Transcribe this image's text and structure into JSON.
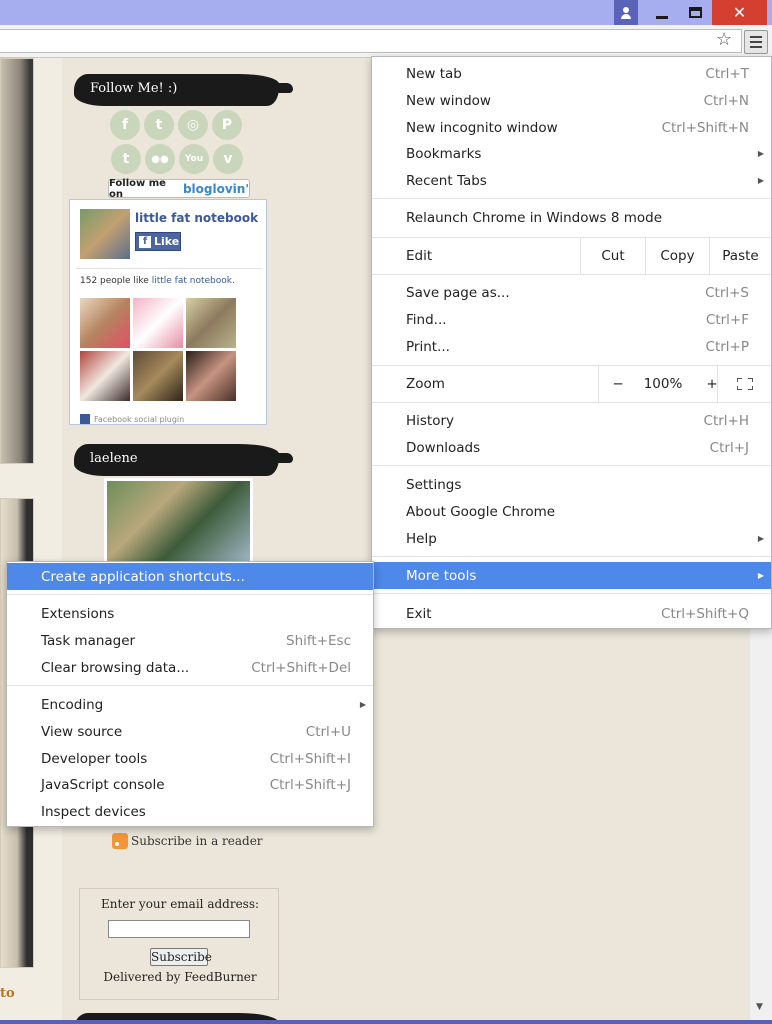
{
  "window": {
    "close_glyph": "✕",
    "colors": {
      "titlebar": "#a6aef0",
      "close": "#d43f30",
      "highlight": "#4e88e8"
    }
  },
  "toolbar": {
    "star_icon": "☆",
    "menu_icon": "hamburger-menu-icon"
  },
  "blog": {
    "follow_heading": "Follow Me! :)",
    "social_icons": [
      "facebook",
      "twitter",
      "instagram",
      "pinterest",
      "tumblr",
      "flickr",
      "youtube",
      "vimeo"
    ],
    "social_glyphs": [
      "f",
      "t",
      "◎",
      "P",
      "t",
      "●●",
      "You",
      "v"
    ],
    "bloglovin_prefix": "Follow me on",
    "bloglovin_brand": "bloglovin'",
    "facebook": {
      "page_name": "little fat notebook",
      "like_label": "Like",
      "like_glyph": "f",
      "count_text": "152 people like",
      "count_link": "little fat notebook.",
      "plugin_label": "Facebook social plugin"
    },
    "author_heading": "laelene",
    "subscribe_reader": "Subscribe in a reader",
    "email_label": "Enter your email address:",
    "subscribe_button": "Subscribe",
    "delivered_by": "Delivered by FeedBurner",
    "left_link_fragment": "to"
  },
  "chrome_menu": {
    "new_tab": {
      "label": "New tab",
      "shortcut": "Ctrl+T"
    },
    "new_window": {
      "label": "New window",
      "shortcut": "Ctrl+N"
    },
    "incognito": {
      "label": "New incognito window",
      "shortcut": "Ctrl+Shift+N"
    },
    "bookmarks": {
      "label": "Bookmarks"
    },
    "recent_tabs": {
      "label": "Recent Tabs"
    },
    "relaunch": {
      "label": "Relaunch Chrome in Windows 8 mode"
    },
    "edit": {
      "label": "Edit",
      "cut": "Cut",
      "copy": "Copy",
      "paste": "Paste"
    },
    "save_page": {
      "label": "Save page as...",
      "shortcut": "Ctrl+S"
    },
    "find": {
      "label": "Find...",
      "shortcut": "Ctrl+F"
    },
    "print": {
      "label": "Print...",
      "shortcut": "Ctrl+P"
    },
    "zoom": {
      "label": "Zoom",
      "minus": "−",
      "level": "100%",
      "plus": "+"
    },
    "history": {
      "label": "History",
      "shortcut": "Ctrl+H"
    },
    "downloads": {
      "label": "Downloads",
      "shortcut": "Ctrl+J"
    },
    "settings": {
      "label": "Settings"
    },
    "about": {
      "label": "About Google Chrome"
    },
    "help": {
      "label": "Help"
    },
    "more_tools": {
      "label": "More tools"
    },
    "exit": {
      "label": "Exit",
      "shortcut": "Ctrl+Shift+Q"
    }
  },
  "more_tools_menu": {
    "create_shortcuts": {
      "label": "Create application shortcuts..."
    },
    "extensions": {
      "label": "Extensions"
    },
    "task_manager": {
      "label": "Task manager",
      "shortcut": "Shift+Esc"
    },
    "clear_data": {
      "label": "Clear browsing data...",
      "shortcut": "Ctrl+Shift+Del"
    },
    "encoding": {
      "label": "Encoding"
    },
    "view_source": {
      "label": "View source",
      "shortcut": "Ctrl+U"
    },
    "dev_tools": {
      "label": "Developer tools",
      "shortcut": "Ctrl+Shift+I"
    },
    "js_console": {
      "label": "JavaScript console",
      "shortcut": "Ctrl+Shift+J"
    },
    "inspect_devices": {
      "label": "Inspect devices"
    }
  }
}
